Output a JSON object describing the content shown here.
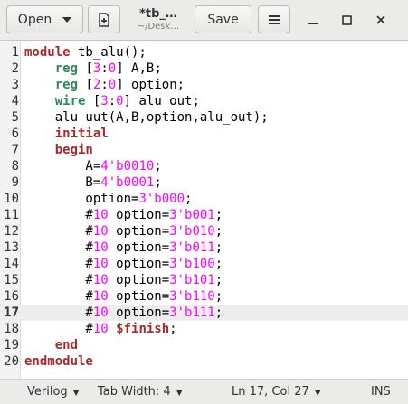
{
  "header": {
    "open_label": "Open",
    "open_icon": "chevron-down-icon",
    "new_icon": "new-document-icon",
    "title": "*tb_…",
    "subtitle": "~/Desk…",
    "save_label": "Save",
    "menu_icon": "hamburger-menu-icon",
    "minimize_icon": "minimize-icon",
    "maximize_icon": "maximize-icon",
    "close_icon": "close-icon"
  },
  "editor": {
    "current_line": 17,
    "lines": [
      {
        "n": "1",
        "tokens": [
          {
            "t": "module",
            "c": "kw"
          },
          {
            "t": " tb_alu();",
            "c": "plain"
          }
        ]
      },
      {
        "n": "2",
        "tokens": [
          {
            "t": "    ",
            "c": "plain"
          },
          {
            "t": "reg",
            "c": "ty"
          },
          {
            "t": " [",
            "c": "plain"
          },
          {
            "t": "3",
            "c": "num"
          },
          {
            "t": ":",
            "c": "plain"
          },
          {
            "t": "0",
            "c": "num"
          },
          {
            "t": "] A,B;",
            "c": "plain"
          }
        ]
      },
      {
        "n": "3",
        "tokens": [
          {
            "t": "    ",
            "c": "plain"
          },
          {
            "t": "reg",
            "c": "ty"
          },
          {
            "t": " [",
            "c": "plain"
          },
          {
            "t": "2",
            "c": "num"
          },
          {
            "t": ":",
            "c": "plain"
          },
          {
            "t": "0",
            "c": "num"
          },
          {
            "t": "] option;",
            "c": "plain"
          }
        ]
      },
      {
        "n": "4",
        "tokens": [
          {
            "t": "    ",
            "c": "plain"
          },
          {
            "t": "wire",
            "c": "ty"
          },
          {
            "t": " [",
            "c": "plain"
          },
          {
            "t": "3",
            "c": "num"
          },
          {
            "t": ":",
            "c": "plain"
          },
          {
            "t": "0",
            "c": "num"
          },
          {
            "t": "] alu_out;",
            "c": "plain"
          }
        ]
      },
      {
        "n": "5",
        "tokens": [
          {
            "t": "    alu uut(A,B,option,alu_out);",
            "c": "plain"
          }
        ]
      },
      {
        "n": "6",
        "tokens": [
          {
            "t": "    ",
            "c": "plain"
          },
          {
            "t": "initial",
            "c": "kw"
          }
        ]
      },
      {
        "n": "7",
        "tokens": [
          {
            "t": "    ",
            "c": "plain"
          },
          {
            "t": "begin",
            "c": "kw"
          }
        ]
      },
      {
        "n": "8",
        "tokens": [
          {
            "t": "        A=",
            "c": "plain"
          },
          {
            "t": "4'b0010",
            "c": "num"
          },
          {
            "t": ";",
            "c": "plain"
          }
        ]
      },
      {
        "n": "9",
        "tokens": [
          {
            "t": "        B=",
            "c": "plain"
          },
          {
            "t": "4'b0001",
            "c": "num"
          },
          {
            "t": ";",
            "c": "plain"
          }
        ]
      },
      {
        "n": "10",
        "tokens": [
          {
            "t": "        option=",
            "c": "plain"
          },
          {
            "t": "3'b000",
            "c": "num"
          },
          {
            "t": ";",
            "c": "plain"
          }
        ]
      },
      {
        "n": "11",
        "tokens": [
          {
            "t": "        #",
            "c": "plain"
          },
          {
            "t": "10",
            "c": "num"
          },
          {
            "t": " option=",
            "c": "plain"
          },
          {
            "t": "3'b001",
            "c": "num"
          },
          {
            "t": ";",
            "c": "plain"
          }
        ]
      },
      {
        "n": "12",
        "tokens": [
          {
            "t": "        #",
            "c": "plain"
          },
          {
            "t": "10",
            "c": "num"
          },
          {
            "t": " option=",
            "c": "plain"
          },
          {
            "t": "3'b010",
            "c": "num"
          },
          {
            "t": ";",
            "c": "plain"
          }
        ]
      },
      {
        "n": "13",
        "tokens": [
          {
            "t": "        #",
            "c": "plain"
          },
          {
            "t": "10",
            "c": "num"
          },
          {
            "t": " option=",
            "c": "plain"
          },
          {
            "t": "3'b011",
            "c": "num"
          },
          {
            "t": ";",
            "c": "plain"
          }
        ]
      },
      {
        "n": "14",
        "tokens": [
          {
            "t": "        #",
            "c": "plain"
          },
          {
            "t": "10",
            "c": "num"
          },
          {
            "t": " option=",
            "c": "plain"
          },
          {
            "t": "3'b100",
            "c": "num"
          },
          {
            "t": ";",
            "c": "plain"
          }
        ]
      },
      {
        "n": "15",
        "tokens": [
          {
            "t": "        #",
            "c": "plain"
          },
          {
            "t": "10",
            "c": "num"
          },
          {
            "t": " option=",
            "c": "plain"
          },
          {
            "t": "3'b101",
            "c": "num"
          },
          {
            "t": ";",
            "c": "plain"
          }
        ]
      },
      {
        "n": "16",
        "tokens": [
          {
            "t": "        #",
            "c": "plain"
          },
          {
            "t": "10",
            "c": "num"
          },
          {
            "t": " option=",
            "c": "plain"
          },
          {
            "t": "3'b110",
            "c": "num"
          },
          {
            "t": ";",
            "c": "plain"
          }
        ]
      },
      {
        "n": "17",
        "tokens": [
          {
            "t": "        #",
            "c": "plain"
          },
          {
            "t": "10",
            "c": "num"
          },
          {
            "t": " option=",
            "c": "plain"
          },
          {
            "t": "3'b111",
            "c": "num"
          },
          {
            "t": ";",
            "c": "plain"
          }
        ]
      },
      {
        "n": "18",
        "tokens": [
          {
            "t": "        #",
            "c": "plain"
          },
          {
            "t": "10",
            "c": "num"
          },
          {
            "t": " ",
            "c": "plain"
          },
          {
            "t": "$finish",
            "c": "kw"
          },
          {
            "t": ";",
            "c": "plain"
          }
        ]
      },
      {
        "n": "19",
        "tokens": [
          {
            "t": "    ",
            "c": "plain"
          },
          {
            "t": "end",
            "c": "kw"
          }
        ]
      },
      {
        "n": "20",
        "tokens": [
          {
            "t": "endmodule",
            "c": "kw"
          }
        ]
      }
    ]
  },
  "statusbar": {
    "language": "Verilog",
    "tab_width": "Tab Width: 4",
    "position": "Ln 17, Col 27",
    "mode": "INS"
  }
}
